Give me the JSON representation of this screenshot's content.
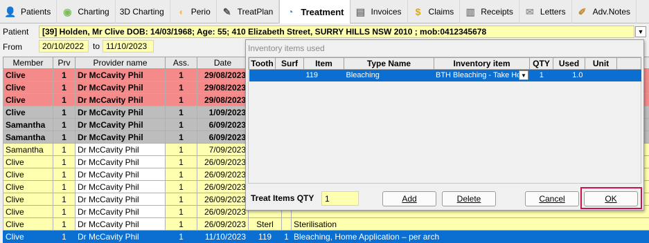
{
  "tabs": [
    {
      "label": "Patients",
      "icon": "patient-icon"
    },
    {
      "label": "Charting",
      "icon": "charting-icon"
    },
    {
      "label": "3D Charting",
      "icon": "none"
    },
    {
      "label": "Perio",
      "icon": "perio-tooth-icon"
    },
    {
      "label": "TreatPlan",
      "icon": "treatplan-icon"
    },
    {
      "label": "Treatment",
      "icon": "treatment-tooth-icon",
      "active": true
    },
    {
      "label": "Invoices",
      "icon": "invoice-icon"
    },
    {
      "label": "Claims",
      "icon": "dollar-icon"
    },
    {
      "label": "Receipts",
      "icon": "receipt-icon"
    },
    {
      "label": "Letters",
      "icon": "envelope-icon"
    },
    {
      "label": "Adv.Notes",
      "icon": "notes-icon"
    }
  ],
  "patient": {
    "label": "Patient",
    "value": "[39] Holden, Mr Clive DOB: 14/03/1968; Age: 55; 410 Elizabeth Street, SURRY HILLS NSW 2010 ; mob:0412345678"
  },
  "range": {
    "from_label": "From",
    "from": "20/10/2022",
    "to_label": "to",
    "to": "11/10/2023"
  },
  "grid": {
    "headers": [
      "Member",
      "Prv",
      "Provider name",
      "Ass.",
      "Date"
    ],
    "rows": [
      {
        "style": "pink",
        "member": "Clive",
        "prv": "1",
        "provider": "Dr McCavity Phil",
        "ass": "1",
        "date": "29/08/2023"
      },
      {
        "style": "pink",
        "member": "Clive",
        "prv": "1",
        "provider": "Dr McCavity Phil",
        "ass": "1",
        "date": "29/08/2023"
      },
      {
        "style": "pink",
        "member": "Clive",
        "prv": "1",
        "provider": "Dr McCavity Phil",
        "ass": "1",
        "date": "29/08/2023"
      },
      {
        "style": "grey",
        "member": "Clive",
        "prv": "1",
        "provider": "Dr McCavity Phil",
        "ass": "1",
        "date": "1/09/2023"
      },
      {
        "style": "grey",
        "member": "Samantha",
        "prv": "1",
        "provider": "Dr McCavity Phil",
        "ass": "1",
        "date": "6/09/2023"
      },
      {
        "style": "grey",
        "member": "Samantha",
        "prv": "1",
        "provider": "Dr McCavity Phil",
        "ass": "1",
        "date": "6/09/2023"
      },
      {
        "style": "yel",
        "member": "Samantha",
        "prv": "1",
        "provider": "Dr McCavity Phil",
        "ass": "1",
        "date": "7/09/2023"
      },
      {
        "style": "yel",
        "member": "Clive",
        "prv": "1",
        "provider": "Dr McCavity Phil",
        "ass": "1",
        "date": "26/09/2023"
      },
      {
        "style": "yel",
        "member": "Clive",
        "prv": "1",
        "provider": "Dr McCavity Phil",
        "ass": "1",
        "date": "26/09/2023"
      },
      {
        "style": "yel",
        "member": "Clive",
        "prv": "1",
        "provider": "Dr McCavity Phil",
        "ass": "1",
        "date": "26/09/2023"
      },
      {
        "style": "yel",
        "member": "Clive",
        "prv": "1",
        "provider": "Dr McCavity Phil",
        "ass": "1",
        "date": "26/09/2023"
      },
      {
        "style": "yel",
        "member": "Clive",
        "prv": "1",
        "provider": "Dr McCavity Phil",
        "ass": "1",
        "date": "26/09/2023"
      },
      {
        "style": "yel",
        "member": "Clive",
        "prv": "1",
        "provider": "Dr McCavity Phil",
        "ass": "1",
        "date": "26/09/2023",
        "extra": "Sterilisation",
        "extra_partial": "Sterl"
      },
      {
        "style": "sel",
        "member": "Clive",
        "prv": "1",
        "provider": "Dr McCavity Phil",
        "ass": "1",
        "date": "11/10/2023",
        "item": "119",
        "qty": "1",
        "desc": "Bleaching, Home Application – per arch"
      }
    ]
  },
  "dialog": {
    "title": "Inventory items used",
    "headers": [
      "Tooth",
      "Surf",
      "Item",
      "Type Name",
      "Inventory item",
      "QTY",
      "Used",
      "Unit"
    ],
    "rows": [
      {
        "tooth": "",
        "surf": "",
        "item": "119",
        "type": "Bleaching",
        "inventory": "BTH Bleaching - Take Ho",
        "qty": "1",
        "used": "1.0",
        "unit": ""
      }
    ],
    "treat_qty_label": "Treat Items QTY",
    "treat_qty": "1",
    "buttons": {
      "add": "Add",
      "delete": "Delete",
      "cancel": "Cancel",
      "ok": "OK"
    }
  },
  "colors": {
    "highlight": "#0a6fd1",
    "pink": "#f48a8a",
    "grey": "#bdbdbd",
    "yellow": "#ffffb0",
    "ok_outline": "#c8134b"
  }
}
